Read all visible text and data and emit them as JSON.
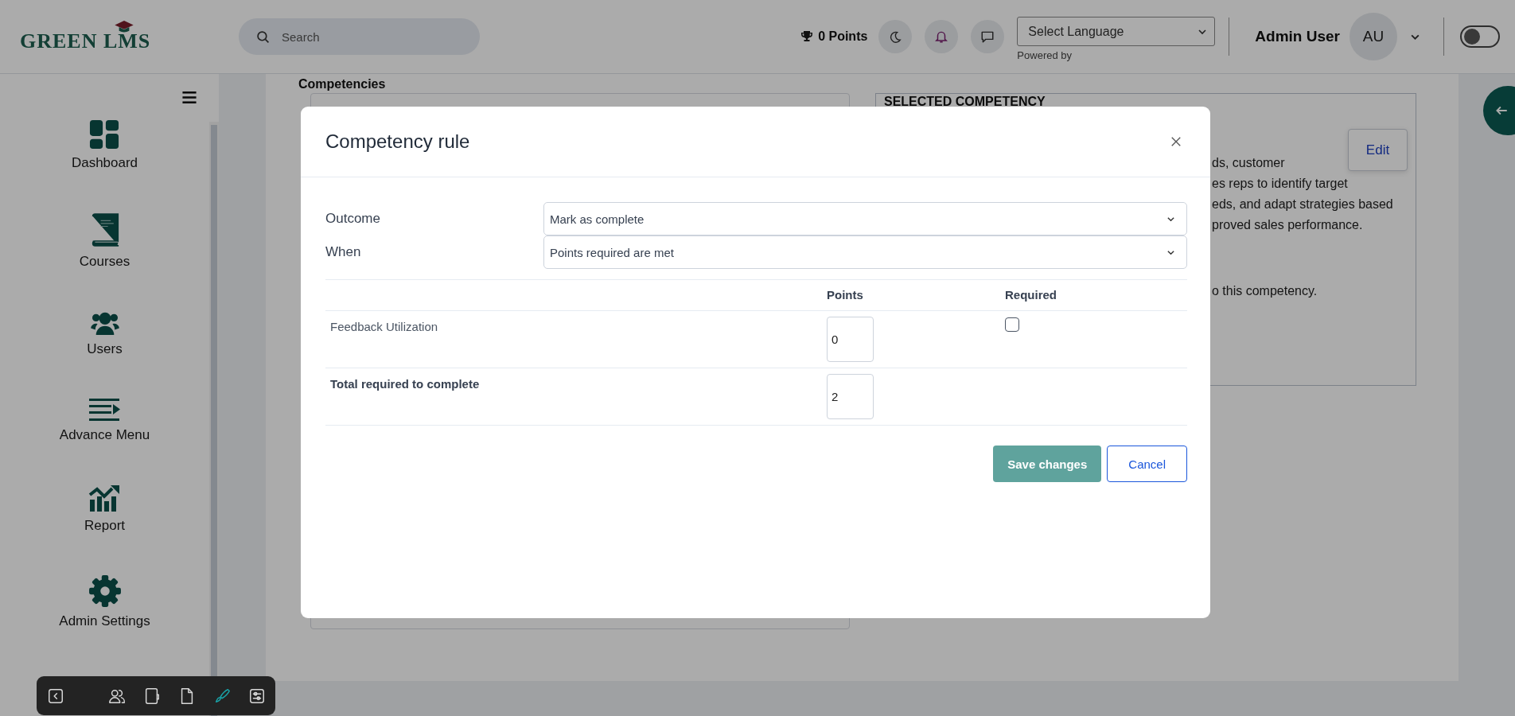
{
  "header": {
    "logo": "GREEN LMS",
    "search": {
      "placeholder": "Search"
    },
    "points": "0 Points",
    "language_select": "Select Language",
    "powered_by": "Powered by",
    "user_name": "Admin User",
    "avatar": "AU",
    "theme_toggle": {
      "on": false
    }
  },
  "sidebar": {
    "items": [
      {
        "label": "Dashboard",
        "kind": "dashboard"
      },
      {
        "label": "Courses",
        "kind": "book"
      },
      {
        "label": "Users",
        "kind": "users"
      },
      {
        "label": "Advance Menu",
        "kind": "menu"
      },
      {
        "label": "Report",
        "kind": "chart"
      },
      {
        "label": "Admin Settings",
        "kind": "gear"
      }
    ]
  },
  "toolbar": {
    "tools": [
      {
        "kind": "back",
        "selected": false
      },
      {
        "kind": "users",
        "selected": false
      },
      {
        "kind": "notebook",
        "selected": false
      },
      {
        "kind": "file",
        "selected": false
      },
      {
        "kind": "brush",
        "selected": true
      },
      {
        "kind": "sliders",
        "selected": false
      }
    ]
  },
  "page": {
    "heading": "Competencies",
    "selected_panel": {
      "title": "SELECTED COMPETENCY",
      "edit": "Edit",
      "paragraphs": [
        {
          "lines": [
            "ds, customer",
            "es reps to identify target",
            "eds, and adapt strategies based",
            "proved sales performance."
          ]
        },
        {
          "lines": [
            "o this competency."
          ]
        }
      ]
    }
  },
  "modal": {
    "title": "Competency rule",
    "fields": [
      {
        "label": "Outcome",
        "value": "Mark as complete"
      },
      {
        "label": "When",
        "value": "Points required are met"
      }
    ],
    "table": {
      "columns": [
        "Points",
        "Required"
      ],
      "rows": [
        {
          "name": "Feedback Utilization",
          "points": "0",
          "required": false
        }
      ],
      "total": {
        "label": "Total required to complete",
        "points": "2"
      }
    },
    "buttons": {
      "save": "Save changes",
      "cancel": "Cancel"
    }
  }
}
